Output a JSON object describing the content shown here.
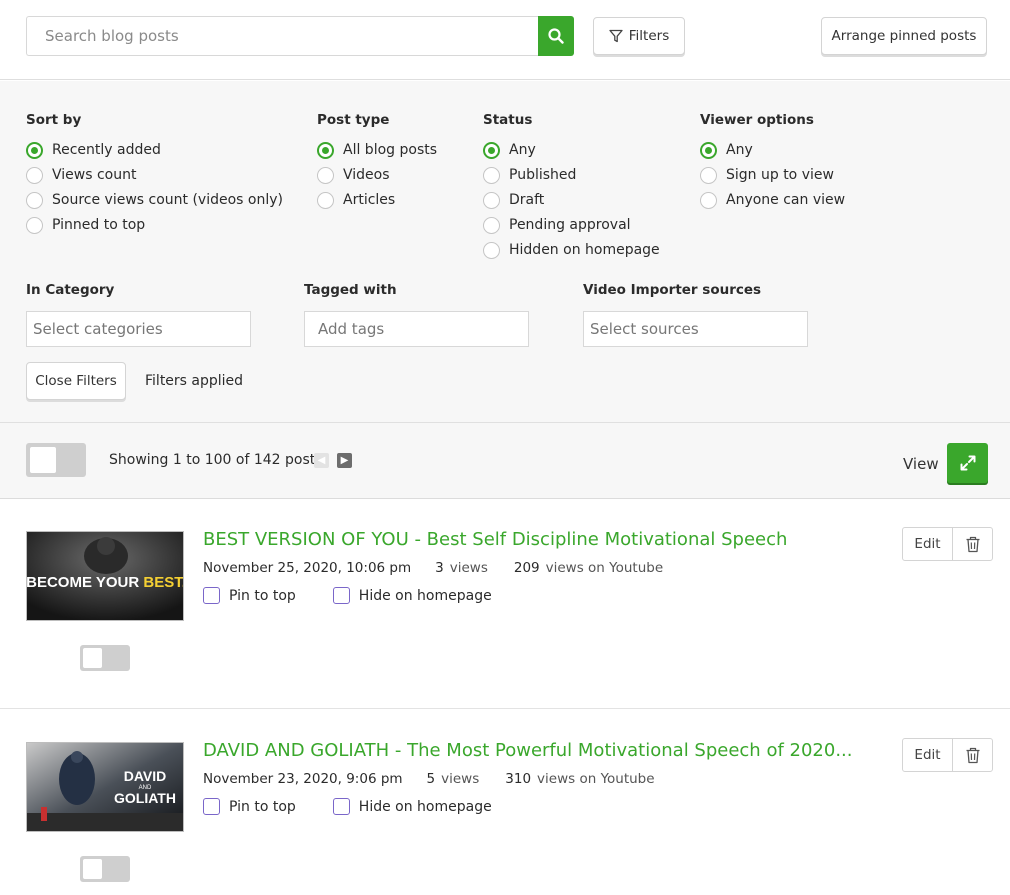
{
  "search": {
    "placeholder": "Search blog posts"
  },
  "toolbar": {
    "filters_label": "Filters",
    "arrange_label": "Arrange pinned posts"
  },
  "filters": {
    "sort_by": {
      "title": "Sort by",
      "options": [
        "Recently added",
        "Views count",
        "Source views count (videos only)",
        "Pinned to top"
      ],
      "selected": 0
    },
    "post_type": {
      "title": "Post type",
      "options": [
        "All blog posts",
        "Videos",
        "Articles"
      ],
      "selected": 0
    },
    "status": {
      "title": "Status",
      "options": [
        "Any",
        "Published",
        "Draft",
        "Pending approval",
        "Hidden on homepage"
      ],
      "selected": 0
    },
    "viewer_options": {
      "title": "Viewer options",
      "options": [
        "Any",
        "Sign up to view",
        "Anyone can view"
      ],
      "selected": 0
    },
    "category": {
      "title": "In Category",
      "placeholder": "Select categories"
    },
    "tags": {
      "title": "Tagged with",
      "placeholder": "Add tags"
    },
    "sources": {
      "title": "Video Importer sources",
      "placeholder": "Select sources"
    },
    "close_label": "Close Filters",
    "applied_label": "Filters applied"
  },
  "pager": {
    "showing_text": "Showing 1 to 100 of 142 posts",
    "view_label": "View"
  },
  "posts": [
    {
      "title": "BEST VERSION OF YOU - Best Self Discipline Motivational Speech",
      "date": "November 25, 2020, 10:06 pm",
      "views": "3",
      "views_label": "views",
      "youtube_views": "209",
      "youtube_label": "views on Youtube",
      "pin_label": "Pin to top",
      "hide_label": "Hide on homepage",
      "edit_label": "Edit",
      "thumb_text": [
        "BECOME YOUR",
        "BEST."
      ]
    },
    {
      "title": "DAVID AND GOLIATH - The Most Powerful Motivational Speech of 2020...",
      "date": "November 23, 2020, 9:06 pm",
      "views": "5",
      "views_label": "views",
      "youtube_views": "310",
      "youtube_label": "views on Youtube",
      "pin_label": "Pin to top",
      "hide_label": "Hide on homepage",
      "edit_label": "Edit",
      "thumb_text": [
        "DAVID",
        "AND",
        "GOLIATH"
      ]
    }
  ],
  "colors": {
    "accent": "#3aa72c",
    "checkbox": "#7a66c9"
  }
}
